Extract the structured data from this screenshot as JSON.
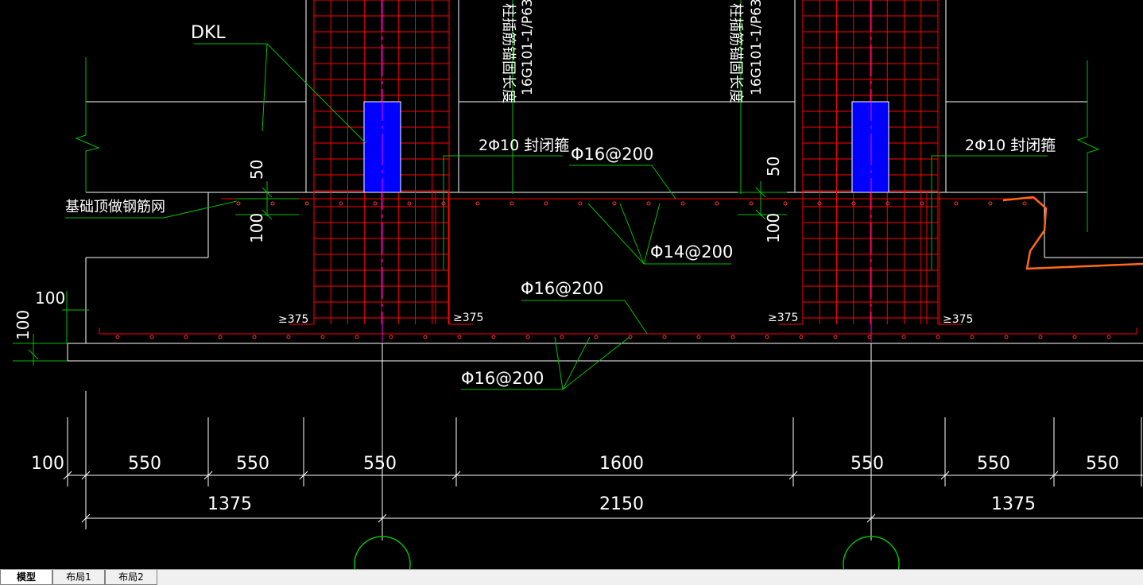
{
  "drawing": {
    "labels": {
      "dkl": "DKL",
      "anchor_left": "柱插筋锚固长度",
      "ref_left": "16G101-1/P63",
      "anchor_right": "柱插筋锚固长度",
      "ref_right": "16G101-1/P63",
      "closed_stirrup_left": "2Φ10 封闭箍",
      "closed_stirrup_right": "2Φ10 封闭箍",
      "top_bar": "Φ16@200",
      "top_mesh": "基础顶做钢筋网",
      "mid_bar": "Φ14@200",
      "bottom_bar_upper": "Φ16@200",
      "bottom_bar_lower": "Φ16@200",
      "dim_50_left": "50",
      "dim_100_left": "100",
      "dim_50_right": "50",
      "dim_100_right": "100",
      "dim_100_edge_h": "100",
      "dim_100_edge_v": "100",
      "ge375_1": "≥375",
      "ge375_2": "≥375",
      "ge375_3": "≥375",
      "ge375_4": "≥375"
    },
    "dim_row1": [
      "100",
      "550",
      "550",
      "550",
      "1600",
      "550",
      "550",
      "550"
    ],
    "dim_row2": [
      "1375",
      "2150",
      "1375"
    ]
  },
  "layout_tabs": [
    {
      "label": "模型",
      "active": true
    },
    {
      "label": "布局1",
      "active": false
    },
    {
      "label": "布局2",
      "active": false
    }
  ],
  "colors": {
    "background": "#000000",
    "outline": "#ffffff",
    "rebar": "#ff0000",
    "leader": "#00c000",
    "column": "#0000ff",
    "axis": "#ff00ff",
    "markup": "#ff6a1a"
  }
}
